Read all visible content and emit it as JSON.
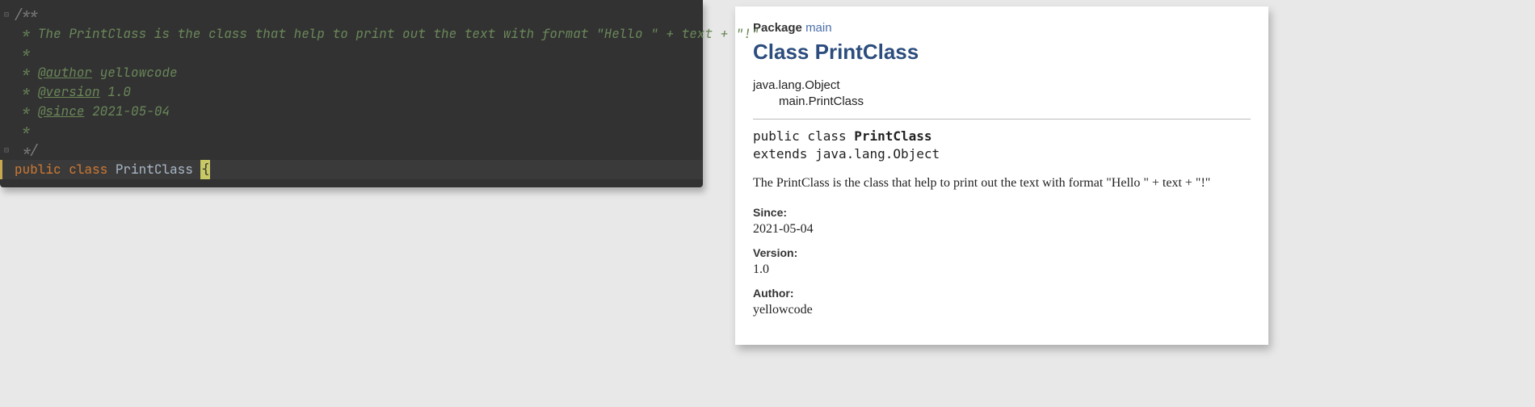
{
  "code": {
    "lines": [
      {
        "raw": "/**"
      },
      {
        "raw": " * The PrintClass is the class that help to print out the text with format \"Hello \" + text + \"!\""
      },
      {
        "raw": " *"
      },
      {
        "prefix": " * ",
        "tag": "@author",
        "value": " yellowcode"
      },
      {
        "prefix": " * ",
        "tag": "@version",
        "value": " 1.0"
      },
      {
        "prefix": " * ",
        "tag": "@since",
        "value": " 2021-05-04"
      },
      {
        "raw": " *"
      },
      {
        "raw": " */"
      }
    ],
    "decl": {
      "keyword_public": "public",
      "keyword_class": "class",
      "class_name": "PrintClass",
      "brace": "{"
    }
  },
  "doc": {
    "pkg_label": "Package",
    "pkg_name": "main",
    "class_heading": "Class PrintClass",
    "hierarchy_root": "java.lang.Object",
    "hierarchy_child": "main.PrintClass",
    "decl_line1_a": "public class ",
    "decl_line1_b": "PrintClass",
    "decl_line2": "extends java.lang.Object",
    "description": "The PrintClass is the class that help to print out the text with format \"Hello \" + text + \"!\"",
    "since_label": "Since:",
    "since_val": "2021-05-04",
    "version_label": "Version:",
    "version_val": "1.0",
    "author_label": "Author:",
    "author_val": "yellowcode"
  }
}
